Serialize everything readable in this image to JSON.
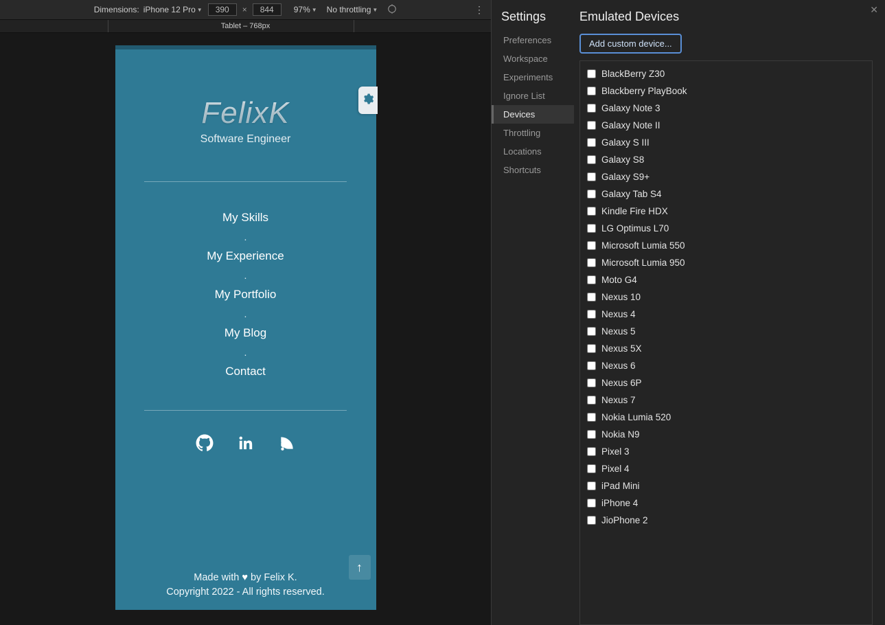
{
  "toolbar": {
    "dimensions_label": "Dimensions:",
    "device_name": "iPhone 12 Pro",
    "width": "390",
    "height": "844",
    "zoom": "97%",
    "throttle": "No throttling"
  },
  "ruler": {
    "label": "Tablet – 768px"
  },
  "phone": {
    "logo": "FelixK",
    "subtitle": "Software Engineer",
    "nav": [
      "My Skills",
      "My Experience",
      "My Portfolio",
      "My Blog",
      "Contact"
    ],
    "footer_line1_a": "Made with ",
    "footer_line1_b": " by Felix K.",
    "footer_line2": "Copyright 2022 - All rights reserved."
  },
  "settings": {
    "title": "Settings",
    "items": [
      "Preferences",
      "Workspace",
      "Experiments",
      "Ignore List",
      "Devices",
      "Throttling",
      "Locations",
      "Shortcuts"
    ],
    "active_index": 4
  },
  "emulated": {
    "title": "Emulated Devices",
    "add_button": "Add custom device...",
    "devices": [
      "BlackBerry Z30",
      "Blackberry PlayBook",
      "Galaxy Note 3",
      "Galaxy Note II",
      "Galaxy S III",
      "Galaxy S8",
      "Galaxy S9+",
      "Galaxy Tab S4",
      "Kindle Fire HDX",
      "LG Optimus L70",
      "Microsoft Lumia 550",
      "Microsoft Lumia 950",
      "Moto G4",
      "Nexus 10",
      "Nexus 4",
      "Nexus 5",
      "Nexus 5X",
      "Nexus 6",
      "Nexus 6P",
      "Nexus 7",
      "Nokia Lumia 520",
      "Nokia N9",
      "Pixel 3",
      "Pixel 4",
      "iPad Mini",
      "iPhone 4",
      "JioPhone 2"
    ]
  }
}
